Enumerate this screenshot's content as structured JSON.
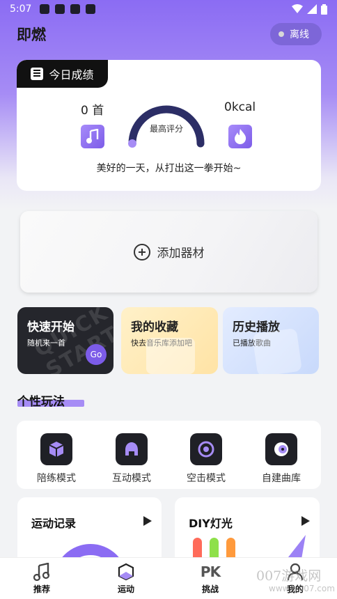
{
  "status_bar": {
    "time": "5:07"
  },
  "header": {
    "app_title": "即燃",
    "offline_label": "离线"
  },
  "score_card": {
    "tag_label": "今日成绩",
    "songs_count": "0 首",
    "calories": "0kcal",
    "gauge_label": "最高评分",
    "gauge_value_fraction": 0,
    "motto": "美好的一天，从打出这一拳开始~"
  },
  "equipment": {
    "add_label": "添加器材"
  },
  "quick_cards": [
    {
      "title": "快速开始",
      "subtitle": "随机来一首",
      "button": "Go",
      "watermark": "QUICK START"
    },
    {
      "title": "我的收藏",
      "subtitle": "快去音乐库添加吧"
    },
    {
      "title": "历史播放",
      "subtitle": "已播放歌曲"
    }
  ],
  "modes_section": {
    "title": "个性玩法",
    "items": [
      {
        "label": "陪练模式",
        "icon": "cube-icon"
      },
      {
        "label": "互动模式",
        "icon": "helmet-icon"
      },
      {
        "label": "空击模式",
        "icon": "target-icon"
      },
      {
        "label": "自建曲库",
        "icon": "disc-icon"
      }
    ]
  },
  "bottom_cards": {
    "record_title": "运动记录",
    "diy_title": "DIY灯光"
  },
  "tabbar": {
    "items": [
      {
        "label": "推荐",
        "icon": "music-note-icon"
      },
      {
        "label": "运动",
        "icon": "cube-icon"
      },
      {
        "label": "挑战",
        "icon": "pk-icon",
        "glyph": "PK"
      },
      {
        "label": "我的",
        "icon": "user-icon"
      }
    ],
    "active_index": 1
  },
  "watermark": "007游戏网 www.jy007.com",
  "colors": {
    "accent": "#7c5ce8",
    "gauge_track": "#2c2e66",
    "header_gradient_top": "#8b6cf3"
  }
}
